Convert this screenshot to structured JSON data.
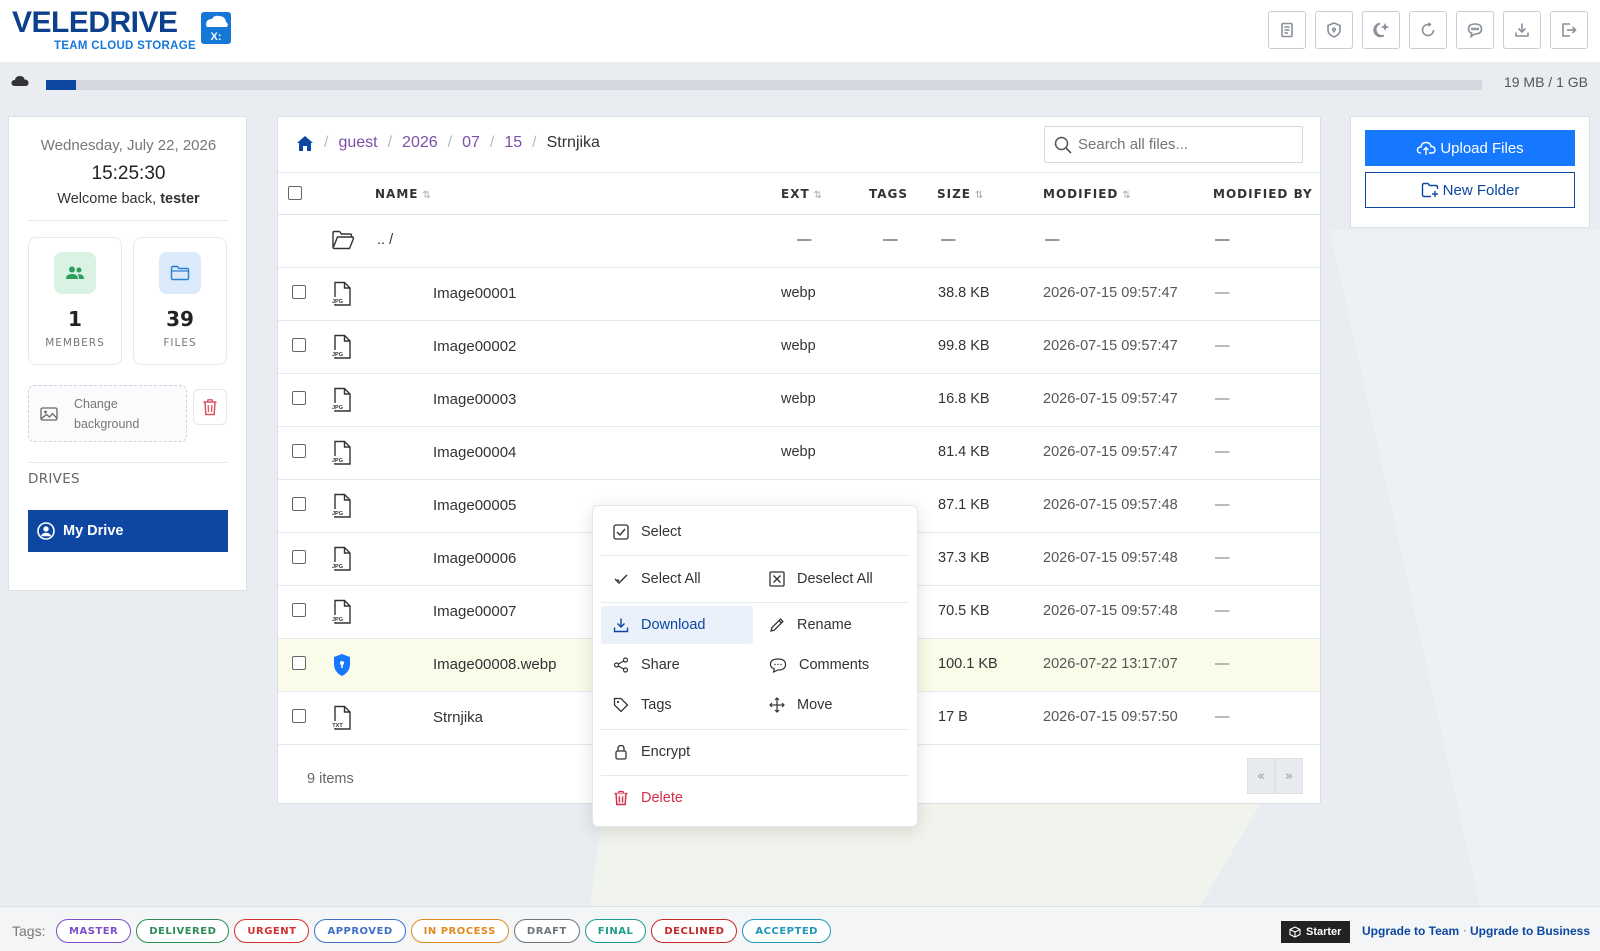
{
  "brand": {
    "name": "VELEDRIVE",
    "subtitle": "TEAM CLOUD STORAGE",
    "badge": "X:"
  },
  "toolbar": {
    "icons": [
      "notes-icon",
      "shield-icon",
      "dark-mode-icon",
      "refresh-icon",
      "chat-icon",
      "download-icon",
      "logout-icon"
    ]
  },
  "storage": {
    "used_text": "19 MB / 1 GB",
    "used_fraction": 0.019
  },
  "sidebar": {
    "date": "Wednesday, July 22, 2026",
    "time": "15:25:30",
    "welcome_prefix": "Welcome back,",
    "username": "tester",
    "members_count": "1",
    "members_label": "MEMBERS",
    "files_count": "39",
    "files_label": "FILES",
    "change_bg_line1": "Change",
    "change_bg_line2": "background",
    "drives_label": "DRIVES",
    "drive_name": "My Drive"
  },
  "breadcrumb": {
    "parts": [
      "guest",
      "2026",
      "07",
      "15"
    ],
    "current": "Strnjika"
  },
  "search": {
    "placeholder": "Search all files..."
  },
  "table": {
    "headers": {
      "name": "NAME",
      "ext": "EXT",
      "tags": "TAGS",
      "size": "SIZE",
      "modified": "MODIFIED",
      "modified_by": "MODIFIED BY"
    },
    "parent": {
      "name": ".. /",
      "ext": "—",
      "tags": "—",
      "size": "—",
      "modified": "—",
      "modified_by": "—"
    },
    "rows": [
      {
        "name": "Image00001",
        "ext": "webp",
        "size": "38.8 KB",
        "modified": "2026-07-15 09:57:47",
        "modified_by": "—",
        "icon": "JPG"
      },
      {
        "name": "Image00002",
        "ext": "webp",
        "size": "99.8 KB",
        "modified": "2026-07-15 09:57:47",
        "modified_by": "—",
        "icon": "JPG"
      },
      {
        "name": "Image00003",
        "ext": "webp",
        "size": "16.8 KB",
        "modified": "2026-07-15 09:57:47",
        "modified_by": "—",
        "icon": "JPG"
      },
      {
        "name": "Image00004",
        "ext": "webp",
        "size": "81.4 KB",
        "modified": "2026-07-15 09:57:47",
        "modified_by": "—",
        "icon": "JPG"
      },
      {
        "name": "Image00005",
        "ext": "",
        "size": "87.1 KB",
        "modified": "2026-07-15 09:57:48",
        "modified_by": "—",
        "icon": "JPG"
      },
      {
        "name": "Image00006",
        "ext": "",
        "size": "37.3 KB",
        "modified": "2026-07-15 09:57:48",
        "modified_by": "—",
        "icon": "JPG"
      },
      {
        "name": "Image00007",
        "ext": "",
        "size": "70.5 KB",
        "modified": "2026-07-15 09:57:48",
        "modified_by": "—",
        "icon": "JPG"
      },
      {
        "name": "Image00008.webp",
        "ext": "",
        "size": "100.1 KB",
        "modified": "2026-07-22 13:17:07",
        "modified_by": "—",
        "icon": "shield"
      },
      {
        "name": "Strnjika",
        "ext": "",
        "size": "17 B",
        "modified": "2026-07-15 09:57:50",
        "modified_by": "—",
        "icon": "TXT"
      }
    ],
    "item_count": "9 items",
    "pager_prev": "«",
    "pager_next": "»"
  },
  "actions": {
    "upload": "Upload Files",
    "new_folder": "New Folder"
  },
  "context_menu": {
    "select": "Select",
    "select_all": "Select All",
    "deselect_all": "Deselect All",
    "download": "Download",
    "rename": "Rename",
    "share": "Share",
    "comments": "Comments",
    "tags": "Tags",
    "move": "Move",
    "encrypt": "Encrypt",
    "delete": "Delete"
  },
  "footer": {
    "tags_label": "Tags:",
    "tags": [
      {
        "label": "MASTER",
        "color": "#7b4fc9"
      },
      {
        "label": "DELIVERED",
        "color": "#2e8b57"
      },
      {
        "label": "URGENT",
        "color": "#d32f2f"
      },
      {
        "label": "APPROVED",
        "color": "#3f6fc4"
      },
      {
        "label": "IN PROCESS",
        "color": "#e08a1e"
      },
      {
        "label": "DRAFT",
        "color": "#6c757d"
      },
      {
        "label": "FINAL",
        "color": "#1f9a8a"
      },
      {
        "label": "DECLINED",
        "color": "#c62828"
      },
      {
        "label": "ACCEPTED",
        "color": "#2196b8"
      }
    ],
    "plan": "Starter",
    "upgrade_team": "Upgrade to Team",
    "upgrade_sep": "·",
    "upgrade_business": "Upgrade to Business"
  }
}
